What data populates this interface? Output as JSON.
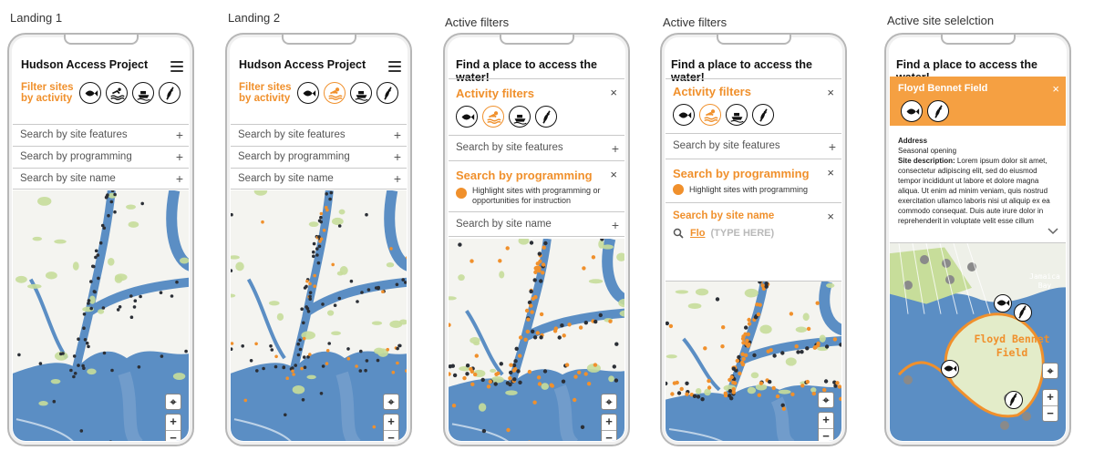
{
  "frames": [
    {
      "caption": "Landing 1",
      "title": "Hudson Access Project",
      "filter_label": "Filter sites by activity",
      "rows": [
        "Search by site features",
        "Search by programming",
        "Search by site name"
      ]
    },
    {
      "caption": "Landing 2",
      "title": "Hudson Access Project",
      "filter_label": "Filter sites by activity",
      "rows": [
        "Search by site features",
        "Search by programming",
        "Search by site name"
      ]
    },
    {
      "caption": "Active filters",
      "title": "Find a place to access the water!",
      "activity_filters": "Activity filters",
      "features": "Search by site features",
      "programming": "Search by programming",
      "programming_option": "Highlight sites with programming or opportunities for instruction",
      "site_name": "Search by site name"
    },
    {
      "caption": "Active filters",
      "title": "Find a place to access the water!",
      "activity_filters": "Activity filters",
      "features": "Search by site features",
      "programming": "Search by programming",
      "programming_option": "Highlight sites with programming",
      "site_name": "Search by site name",
      "search_value": "Flo",
      "search_hint": "(TYPE HERE)"
    },
    {
      "caption": "Active site selelction",
      "title": "Find a place to access the water!",
      "site_name": "Floyd Bennet Field",
      "address_label": "Address",
      "hours": "Seasonal opening",
      "desc_label": "Site description:",
      "desc_text": "Lorem ipsum dolor sit amet, consectetur adipiscing elit, sed do eiusmod tempor incididunt ut labore et dolore magna aliqua. Ut enim ad minim veniam, quis nostrud exercitation ullamco laboris nisi ut aliquip ex ea commodo consequat. Duis aute irure dolor in reprehenderit in voluptate velit esse cillum",
      "map_label_bay": "Jamaica Bay",
      "map_label_field": "Floyd Bennet Field"
    }
  ],
  "controls": {
    "locate": "⌖",
    "zoom_in": "+",
    "zoom_out": "−",
    "expand": "+",
    "close": "×"
  },
  "colors": {
    "accent": "#f0902c",
    "water": "#5b8ec4",
    "land": "#f4f4f0",
    "park": "#c7dd9a"
  }
}
